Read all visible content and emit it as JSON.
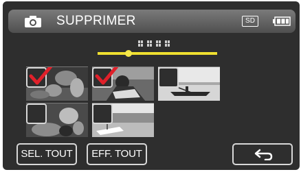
{
  "header": {
    "mode_icon": "camera-icon",
    "title": "SUPPRIMER",
    "media_label": "SD",
    "battery_icon": "battery-icon"
  },
  "navigation": {
    "page_indicator_icon": "page-dots-icon",
    "position_fraction": 0.26
  },
  "thumbnails": [
    {
      "checked": true,
      "scene": "children-field"
    },
    {
      "checked": true,
      "scene": "person-reading"
    },
    {
      "checked": false,
      "scene": "canoe-water"
    },
    {
      "checked": false,
      "scene": "child-outdoors"
    },
    {
      "checked": false,
      "scene": "boat-beach"
    }
  ],
  "buttons": {
    "select_all": "SEL. TOUT",
    "clear_all": "EFF. TOUT",
    "back_icon": "back-arrow-icon"
  },
  "colors": {
    "checkmark": "#e0202a",
    "slider": "#f0e030",
    "header_top": "#7a7a7a",
    "screen_bg": "#2e2e2e"
  }
}
